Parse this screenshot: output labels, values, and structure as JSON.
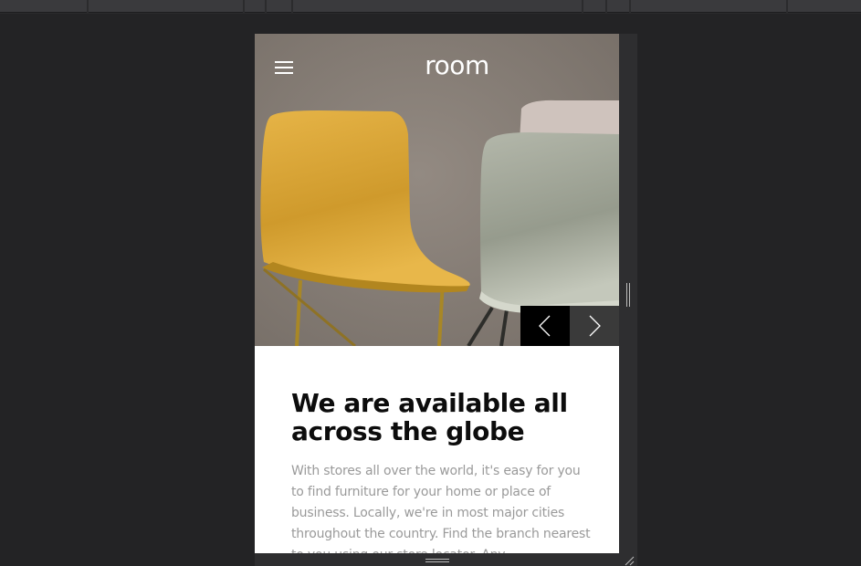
{
  "site": {
    "logo": "room"
  },
  "hero": {
    "menu_icon": "hamburger-menu-icon",
    "prev_icon": "chevron-left-icon",
    "next_icon": "chevron-right-icon"
  },
  "content": {
    "heading": "We are available all across the globe",
    "body": "With stores all over the world, it's easy for you to find furniture for your home or place of business. Locally, we're in most major cities throughout the country. Find the branch nearest to you using our store locator. Any"
  },
  "colors": {
    "page_background": "#232325",
    "device_background": "#ffffff",
    "heading": "#0c0c0c",
    "body_text": "#9a9a9a",
    "prev_button": "#000000",
    "next_button": "#3a3a3a",
    "chair_yellow": "#e0ad3a",
    "chair_sage": "#a6ab9c"
  }
}
